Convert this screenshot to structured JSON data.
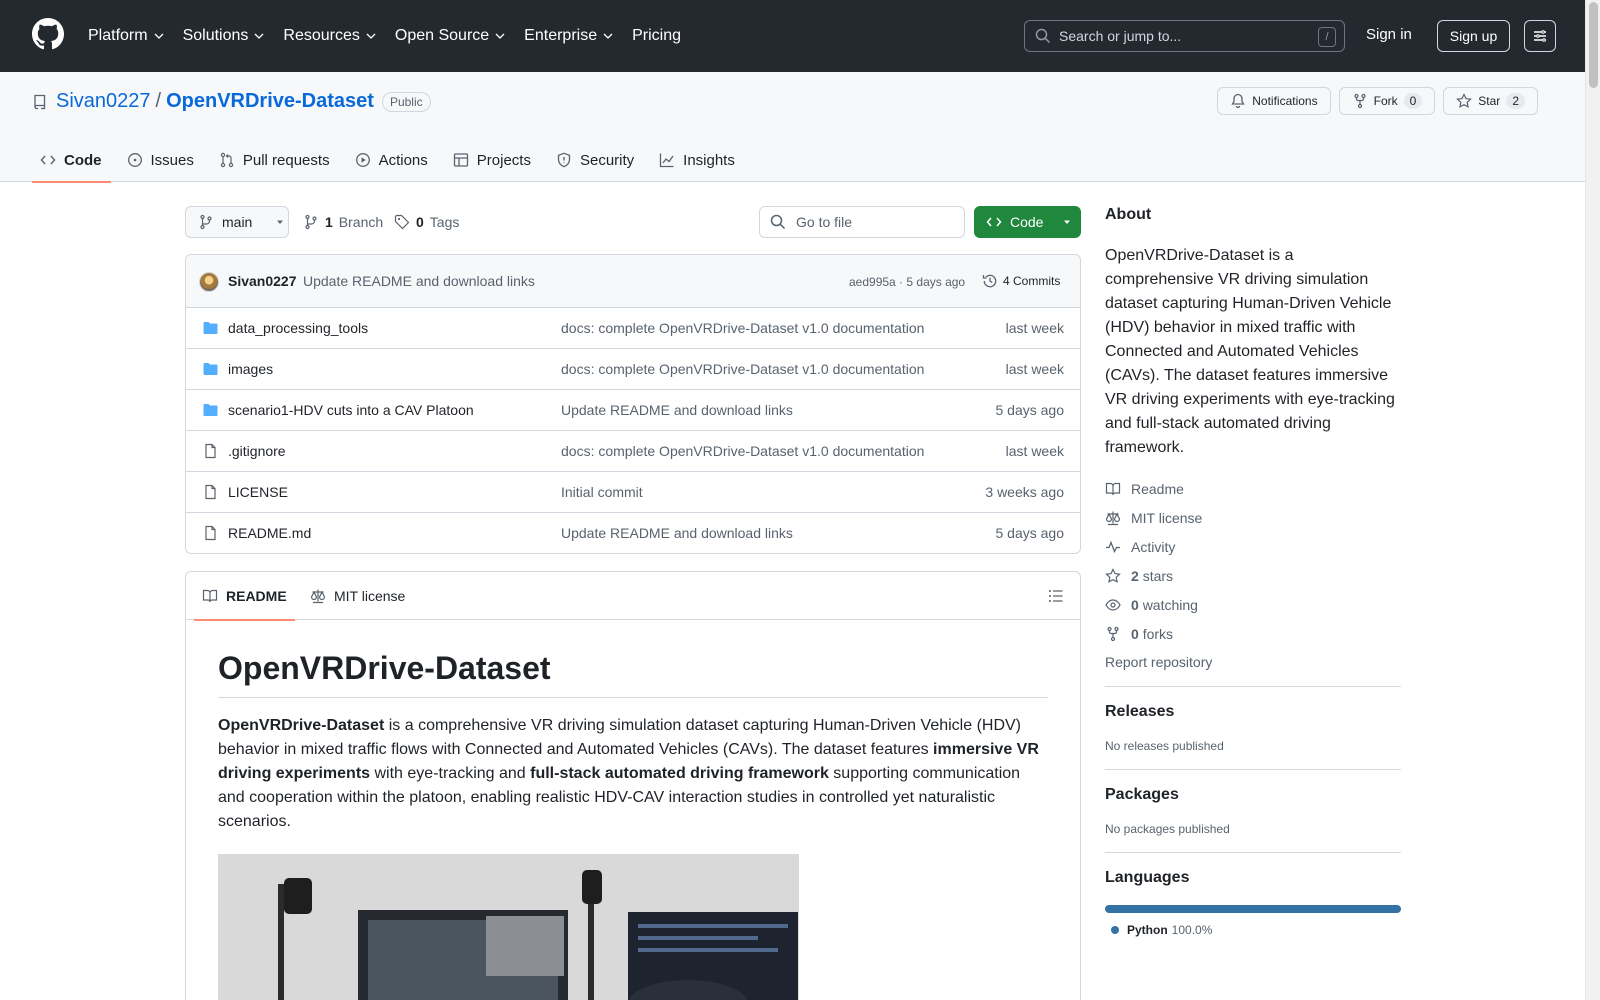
{
  "header": {
    "nav": [
      "Platform",
      "Solutions",
      "Resources",
      "Open Source",
      "Enterprise"
    ],
    "pricing": "Pricing",
    "search_placeholder": "Search or jump to...",
    "search_key": "/",
    "signin": "Sign in",
    "signup": "Sign up"
  },
  "repo": {
    "owner": "Sivan0227",
    "separator": "/",
    "name": "OpenVRDrive-Dataset",
    "visibility": "Public",
    "notifications": "Notifications",
    "fork_label": "Fork",
    "fork_count": "0",
    "star_label": "Star",
    "star_count": "2"
  },
  "tabs": [
    "Code",
    "Issues",
    "Pull requests",
    "Actions",
    "Projects",
    "Security",
    "Insights"
  ],
  "toolbar": {
    "branch": "main",
    "branch_count": "1",
    "branch_label": "Branch",
    "tag_count": "0",
    "tag_label": "Tags",
    "goto_placeholder": "Go to file",
    "code_button": "Code"
  },
  "latest_commit": {
    "author": "Sivan0227",
    "message": "Update README and download links",
    "meta": "aed995a · 5 days ago",
    "commits": "4 Commits"
  },
  "files": [
    {
      "type": "folder",
      "name": "data_processing_tools",
      "message": "docs: complete OpenVRDrive-Dataset v1.0 documentation",
      "time": "last week"
    },
    {
      "type": "folder",
      "name": "images",
      "message": "docs: complete OpenVRDrive-Dataset v1.0 documentation",
      "time": "last week"
    },
    {
      "type": "folder",
      "name": "scenario1-HDV cuts into a CAV Platoon",
      "message": "Update README and download links",
      "time": "5 days ago"
    },
    {
      "type": "file",
      "name": ".gitignore",
      "message": "docs: complete OpenVRDrive-Dataset v1.0 documentation",
      "time": "last week"
    },
    {
      "type": "file",
      "name": "LICENSE",
      "message": "Initial commit",
      "time": "3 weeks ago"
    },
    {
      "type": "file",
      "name": "README.md",
      "message": "Update README and download links",
      "time": "5 days ago"
    }
  ],
  "readme": {
    "tab_readme": "README",
    "tab_license": "MIT license",
    "title": "OpenVRDrive-Dataset",
    "p_bold1": "OpenVRDrive-Dataset",
    "p_text1": " is a comprehensive VR driving simulation dataset capturing Human-Driven Vehicle (HDV) behavior in mixed traffic flows with Connected and Automated Vehicles (CAVs). The dataset features ",
    "p_bold2": "immersive VR driving experiments",
    "p_text2": " with eye-tracking and ",
    "p_bold3": "full-stack automated driving framework",
    "p_text3": " supporting communication and cooperation within the platoon, enabling realistic HDV-CAV interaction studies in controlled yet naturalistic scenarios."
  },
  "sidebar": {
    "about_title": "About",
    "about_text": "OpenVRDrive-Dataset is a comprehensive VR driving simulation dataset capturing Human-Driven Vehicle (HDV) behavior in mixed traffic with Connected and Automated Vehicles (CAVs). The dataset features immersive VR driving experiments with eye-tracking and full-stack automated driving framework.",
    "readme": "Readme",
    "license": "MIT license",
    "activity": "Activity",
    "stars_count": "2",
    "stars_label": "stars",
    "watching_count": "0",
    "watching_label": "watching",
    "forks_count": "0",
    "forks_label": "forks",
    "report": "Report repository",
    "releases_title": "Releases",
    "releases_text": "No releases published",
    "packages_title": "Packages",
    "packages_text": "No packages published",
    "languages_title": "Languages",
    "language_name": "Python",
    "language_pct": "100.0%",
    "language_share": 1.0
  }
}
